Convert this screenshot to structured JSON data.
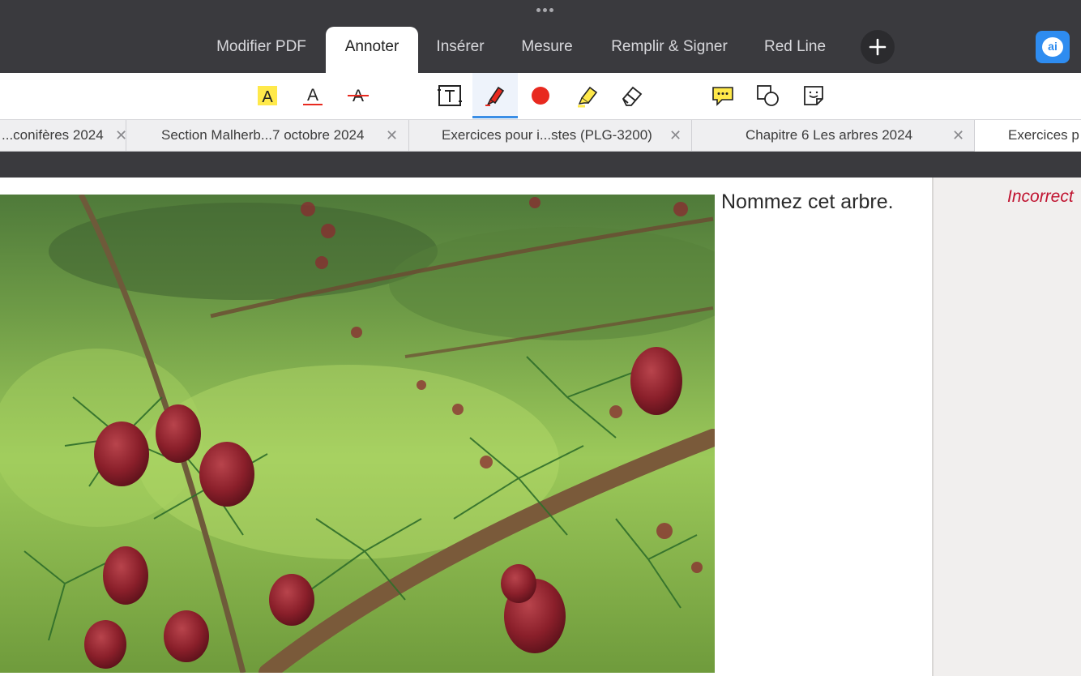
{
  "mode_tabs": [
    {
      "label": "Modifier PDF",
      "active": false
    },
    {
      "label": "Annoter",
      "active": true
    },
    {
      "label": "Insérer",
      "active": false
    },
    {
      "label": "Mesure",
      "active": false
    },
    {
      "label": "Remplir & Signer",
      "active": false
    },
    {
      "label": "Red Line",
      "active": false
    }
  ],
  "ai_button_label": "ai",
  "tools": [
    {
      "name": "highlight-text-icon",
      "active": false
    },
    {
      "name": "underline-text-icon",
      "active": false
    },
    {
      "name": "strikethrough-text-icon",
      "active": false
    },
    {
      "name": "text-box-icon",
      "active": false
    },
    {
      "name": "pen-icon",
      "active": true
    },
    {
      "name": "red-color-dot-icon",
      "active": false
    },
    {
      "name": "highlighter-icon",
      "active": false
    },
    {
      "name": "eraser-icon",
      "active": false
    },
    {
      "name": "comment-icon",
      "active": false
    },
    {
      "name": "shapes-icon",
      "active": false
    },
    {
      "name": "sticky-note-icon",
      "active": false
    }
  ],
  "doc_tabs": [
    {
      "label": "...conifères 2024"
    },
    {
      "label": "Section Malherb...7 octobre 2024"
    },
    {
      "label": "Exercices pour i...stes (PLG-3200)"
    },
    {
      "label": "Chapitre 6 Les arbres  2024"
    },
    {
      "label": "Exercices p"
    }
  ],
  "document": {
    "question": "Nommez cet arbre.",
    "feedback": "Incorrect"
  },
  "colors": {
    "accent": "#3a8ee6",
    "pen_red": "#e8291f",
    "highlight_yellow": "#ffe94a",
    "feedback_red": "#c0122f",
    "chrome_dark": "#3a3a3e"
  }
}
